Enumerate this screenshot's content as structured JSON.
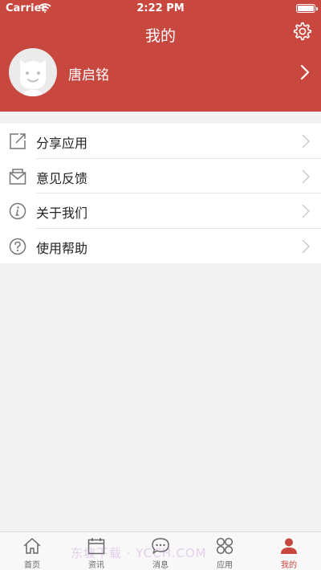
{
  "status_bar": {
    "carrier": "Carrier",
    "time": "2:22 PM"
  },
  "header": {
    "title": "我的",
    "settings_icon": "gear-icon"
  },
  "profile": {
    "username": "唐启铭",
    "avatar_icon": "avatar-face-icon"
  },
  "menu": [
    {
      "label": "分享应用",
      "icon": "share-icon"
    },
    {
      "label": "意见反馈",
      "icon": "mail-icon"
    },
    {
      "label": "关于我们",
      "icon": "info-icon"
    },
    {
      "label": "使用帮助",
      "icon": "help-icon"
    }
  ],
  "tabs": [
    {
      "label": "首页",
      "icon": "home-icon"
    },
    {
      "label": "资讯",
      "icon": "calendar-icon"
    },
    {
      "label": "消息",
      "icon": "chat-icon"
    },
    {
      "label": "应用",
      "icon": "apps-icon"
    },
    {
      "label": "我的",
      "icon": "user-icon",
      "active": true
    }
  ],
  "watermark": "东坡下载 · YCCH.COM",
  "colors": {
    "accent": "#c8473f",
    "background": "#f3f3f3"
  }
}
